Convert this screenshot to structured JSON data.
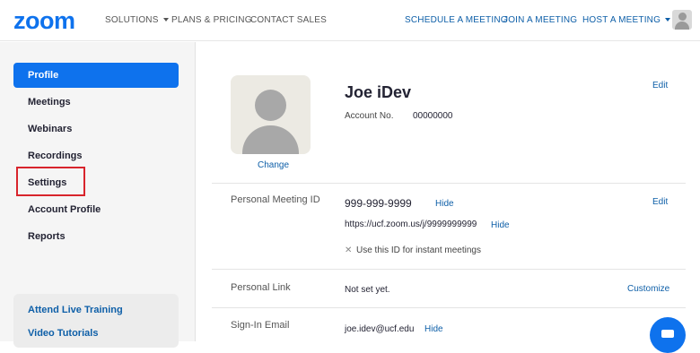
{
  "header": {
    "logo": "zoom",
    "nav_left": [
      {
        "label": "SOLUTIONS",
        "has_caret": true
      },
      {
        "label": "PLANS & PRICING"
      },
      {
        "label": "CONTACT SALES"
      }
    ],
    "nav_right": [
      {
        "label": "SCHEDULE A MEETING"
      },
      {
        "label": "JOIN A MEETING"
      },
      {
        "label": "HOST A MEETING",
        "has_caret": true
      }
    ]
  },
  "sidebar": {
    "items": [
      {
        "label": "Profile",
        "active": true
      },
      {
        "label": "Meetings"
      },
      {
        "label": "Webinars"
      },
      {
        "label": "Recordings"
      },
      {
        "label": "Settings",
        "highlighted": true
      },
      {
        "label": "Account Profile"
      },
      {
        "label": "Reports"
      }
    ],
    "bottom_links": [
      "Attend Live Training",
      "Video Tutorials"
    ]
  },
  "profile": {
    "name": "Joe iDev",
    "edit_label": "Edit",
    "change_label": "Change",
    "account_no_label": "Account No.",
    "account_no": "00000000"
  },
  "meeting_id": {
    "label": "Personal Meeting ID",
    "value": "999-999-9999",
    "hide_label": "Hide",
    "url": "https://ucf.zoom.us/j/9999999999",
    "url_hide_label": "Hide",
    "instant_text": "Use this ID for instant meetings",
    "edit_label": "Edit"
  },
  "personal_link": {
    "label": "Personal Link",
    "value": "Not set yet.",
    "customize_label": "Customize"
  },
  "signin_email": {
    "label": "Sign-In Email",
    "value": "joe.idev@ucf.edu",
    "hide_label": "Hide"
  },
  "colors": {
    "brand": "#0e72ed",
    "link": "#0e5fa8",
    "highlight": "#d8242c"
  }
}
